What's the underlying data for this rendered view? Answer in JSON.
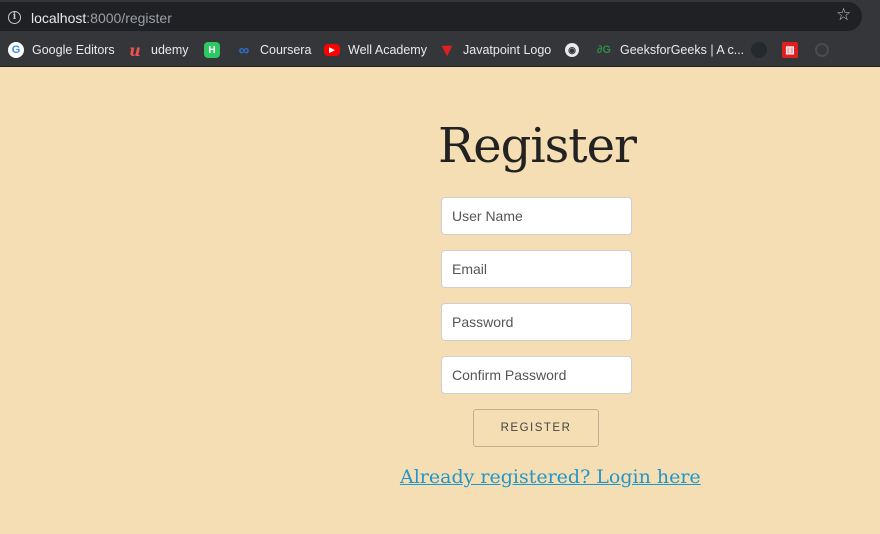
{
  "browser": {
    "url_host": "localhost",
    "url_path": ":8000/register",
    "bookmarks": [
      {
        "label": "Google Editors",
        "icon": "google-icon"
      },
      {
        "label": "udemy",
        "icon": "udemy-icon"
      },
      {
        "label": "",
        "icon": "hackerrank-icon"
      },
      {
        "label": "Coursera",
        "icon": "coursera-icon"
      },
      {
        "label": "Well Academy",
        "icon": "youtube-icon"
      },
      {
        "label": "Javatpoint Logo",
        "icon": "javatpoint-icon"
      },
      {
        "label": "",
        "icon": "globe-icon"
      },
      {
        "label": "GeeksforGeeks | A c...",
        "icon": "geeksforgeeks-icon"
      },
      {
        "label": "",
        "icon": "github-icon"
      },
      {
        "label": "",
        "icon": "red-bookmark-icon"
      },
      {
        "label": "",
        "icon": "faded-circle-icon"
      }
    ]
  },
  "page": {
    "title": "Register",
    "fields": {
      "username_placeholder": "User Name",
      "email_placeholder": "Email",
      "password_placeholder": "Password",
      "confirm_placeholder": "Confirm Password"
    },
    "register_label": "REGISTER",
    "login_link": "Already registered? Login here"
  },
  "colors": {
    "page_background": "#f5deb3",
    "link": "#2196c9",
    "browser_chrome": "#35363a"
  }
}
